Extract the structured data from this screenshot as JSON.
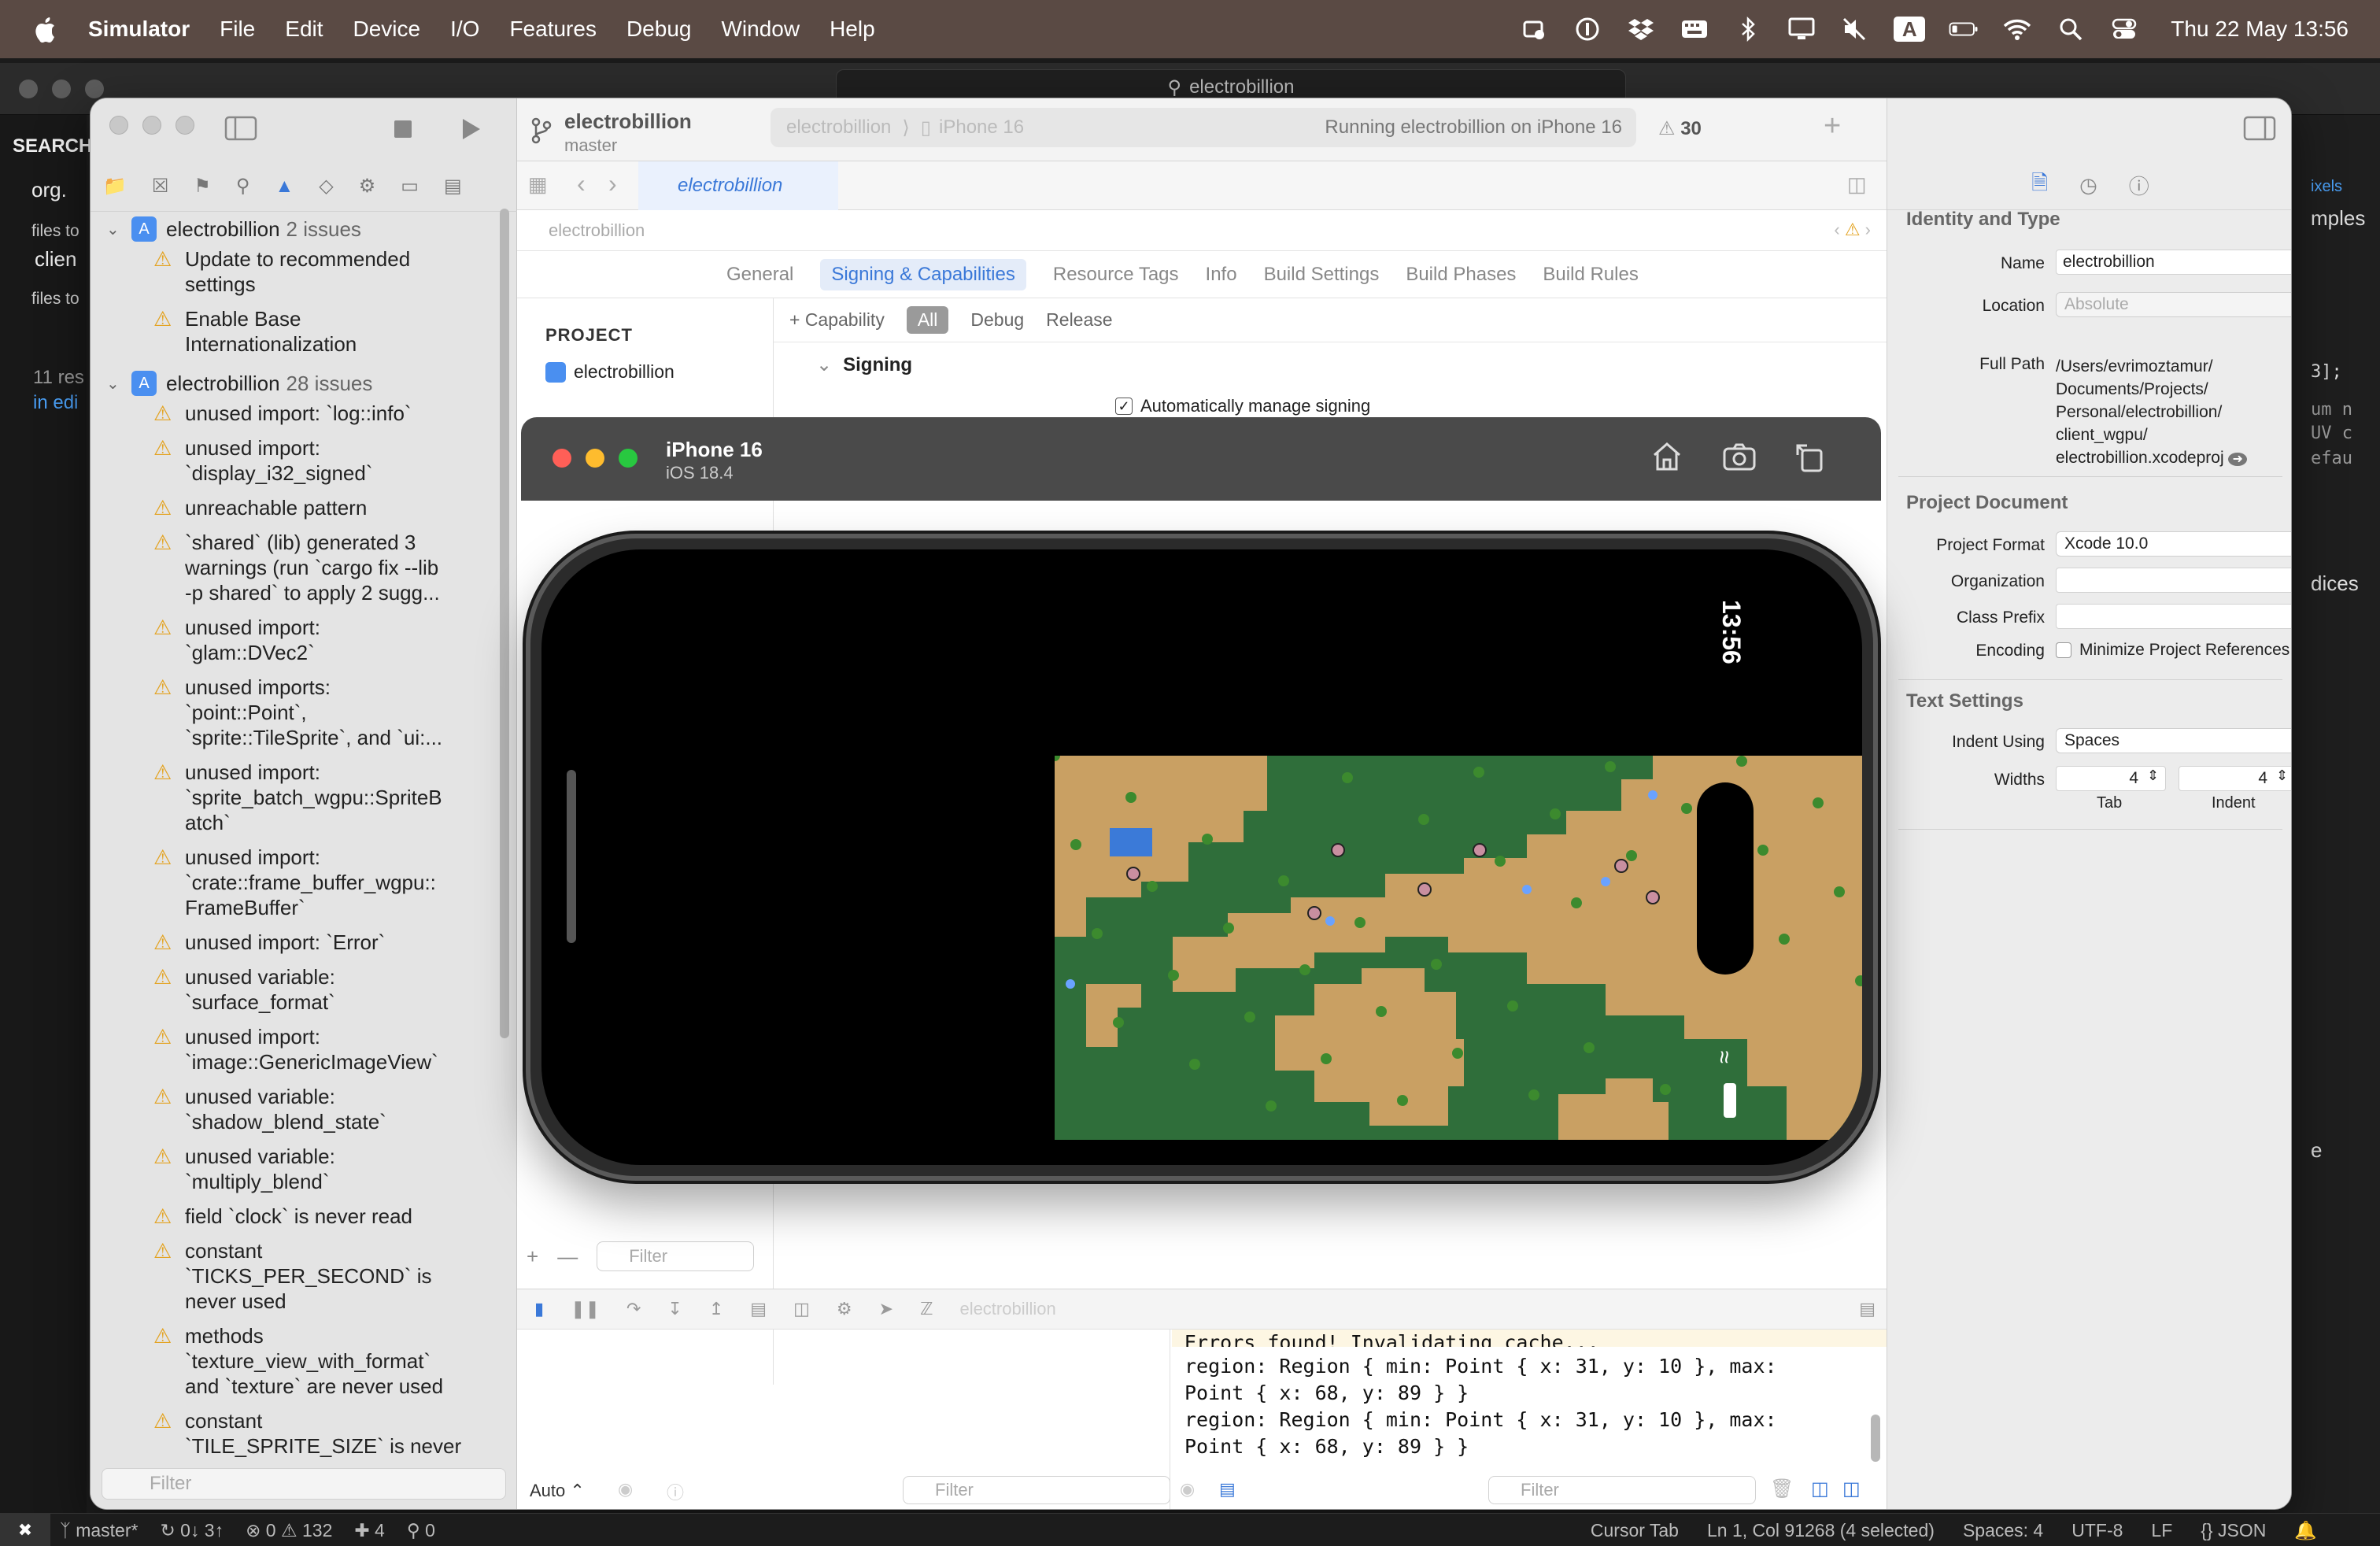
{
  "menubar": {
    "app": "Simulator",
    "items": [
      "File",
      "Edit",
      "Device",
      "I/O",
      "Features",
      "Debug",
      "Window",
      "Help"
    ],
    "clock": "Thu 22 May  13:56",
    "status_icons": [
      "extension-icon",
      "1password-icon",
      "dropbox-icon",
      "keyboard-icon",
      "bluetooth-icon",
      "display-icon",
      "mute-icon",
      "input-source-icon",
      "battery-icon",
      "wifi-icon",
      "spotlight-icon",
      "control-center-icon"
    ],
    "input_source": "A"
  },
  "bg_editor": {
    "search": "electrobillion",
    "sidebar_title": "SEARCH",
    "sidebar_query": "org.",
    "files_to_include": "files to",
    "include_value": "clien",
    "files_to_exclude": "files to",
    "results": "11 res",
    "results_sub": "in edi",
    "right_snippets": [
      "ixels",
      "mples",
      "3];",
      "um n",
      "UV c",
      "efau",
      "dices",
      "e"
    ]
  },
  "xcode": {
    "scheme_name": "electrobillion",
    "scheme_branch": "master",
    "activity_target": "electrobillion",
    "activity_device": "iPhone 16",
    "activity_status": "Running electrobillion on iPhone 16",
    "warning_count": "30",
    "tab_label": "electrobillion",
    "jump_path": "electrobillion",
    "project_tabs": [
      "General",
      "Signing & Capabilities",
      "Resource Tags",
      "Info",
      "Build Settings",
      "Build Phases",
      "Build Rules"
    ],
    "selected_tab": "Signing & Capabilities",
    "project_header": "PROJECT",
    "project_item": "electrobillion",
    "capability_button": "+ Capability",
    "config_filters": [
      "All",
      "Debug",
      "Release"
    ],
    "signing_title": "Signing",
    "auto_manage": "Automatically manage signing",
    "filter_placeholder": "Filter",
    "debug_target": "electrobillion",
    "auto_label": "Auto ⌃",
    "console_top": "Errors found! Invalidating cache...",
    "console_lines": [
      "region: Region { min: Point { x: 31, y: 10 }, max:",
      "Point { x: 68, y: 89 } }",
      "region: Region { min: Point { x: 31, y: 10 }, max:",
      "Point { x: 68, y: 89 } }"
    ]
  },
  "issues": {
    "groups": [
      {
        "title": "electrobillion",
        "count": "2 issues",
        "items": [
          "Update to recommended\nsettings",
          "Enable Base\nInternationalization"
        ]
      },
      {
        "title": "electrobillion",
        "count": "28 issues",
        "items": [
          "unused import: `log::info`",
          "unused import:\n`display_i32_signed`",
          "unreachable pattern",
          "`shared` (lib) generated 3\nwarnings (run `cargo fix --lib\n-p shared` to apply 2 sugg...",
          "unused import:\n`glam::DVec2`",
          "unused imports:\n`point::Point`,\n`sprite::TileSprite`, and `ui:...",
          "unused import:\n`sprite_batch_wgpu::SpriteB\natch`",
          "unused import:\n`crate::frame_buffer_wgpu::\nFrameBuffer`",
          "unused import: `Error`",
          "unused variable:\n`surface_format`",
          "unused import:\n`image::GenericImageView`",
          "unused variable:\n`shadow_blend_state`",
          "unused variable:\n`multiply_blend`",
          "field `clock` is never read",
          "constant\n`TICKS_PER_SECOND` is\nnever used",
          "methods\n`texture_view_with_format`\nand `texture` are never used",
          "constant\n`TILE_SPRITE_SIZE` is never"
        ]
      }
    ],
    "filter_placeholder": "Filter"
  },
  "inspector": {
    "identity_title": "Identity and Type",
    "name_label": "Name",
    "name_value": "electrobillion",
    "location_label": "Location",
    "location_value": "Absolute",
    "fullpath_label": "Full Path",
    "fullpath_value": "/Users/evrimoztamur/\nDocuments/Projects/\nPersonal/electrobillion/\nclient_wgpu/\nelectrobillion.xcodeproj",
    "project_doc_title": "Project Document",
    "format_label": "Project Format",
    "format_value": "Xcode 10.0",
    "org_label": "Organization",
    "prefix_label": "Class Prefix",
    "encoding_label": "Encoding",
    "encoding_value": "Minimize Project References",
    "text_settings_title": "Text Settings",
    "indent_using_label": "Indent Using",
    "indent_using_value": "Spaces",
    "widths_label": "Widths",
    "tab_value": "4",
    "indent_value": "4",
    "tab_caption": "Tab",
    "indent_caption": "Indent"
  },
  "simulator": {
    "device": "iPhone 16",
    "os": "iOS 18.4",
    "time": "13:56"
  },
  "statusbar": {
    "branch": "master*",
    "sync": "0↓ 3↑",
    "errors": "0",
    "warnings": "132",
    "ports": "4",
    "remote": "0",
    "cursor_tab": "Cursor Tab",
    "position": "Ln 1, Col 91268 (4 selected)",
    "spaces": "Spaces: 4",
    "encoding": "UTF-8",
    "eol": "LF",
    "language": "{} JSON"
  },
  "colors": {
    "accent": "#3a78d8",
    "warning": "#e3a322",
    "grass": "#2f6e3a",
    "sand": "#c9a063",
    "water": "#3b7ad8"
  }
}
